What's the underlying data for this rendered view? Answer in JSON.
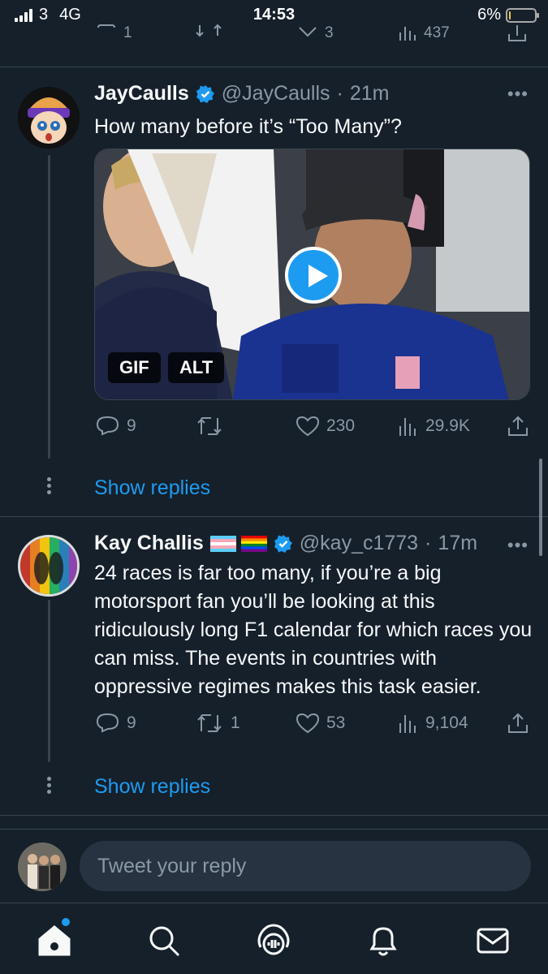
{
  "status_bar": {
    "carrier": "3",
    "network": "4G",
    "time": "14:53",
    "battery": "6%",
    "battery_level": 0.06
  },
  "top_actions": {
    "replies": "1",
    "retweets": "",
    "likes": "3",
    "views": "437"
  },
  "tweets": [
    {
      "name": "JayCaulls",
      "handle": "@JayCaulls",
      "time": "21m",
      "text": "How many before it’s “Too Many”?",
      "media_badges": [
        "GIF",
        "ALT"
      ],
      "replies": "9",
      "retweets": "",
      "likes": "230",
      "views": "29.9K",
      "show_replies": "Show replies"
    },
    {
      "name": "Kay Challis",
      "flags": "🏳️‍⚧️🏳️‍🌈",
      "handle": "@kay_c1773",
      "time": "17m",
      "text": "24 races is far too many, if you’re a big motorsport fan you’ll be looking at this ridiculously long F1 calendar for which races you can miss. The events in countries with oppressive regimes makes this task easier.",
      "replies": "9",
      "retweets": "1",
      "likes": "53",
      "views": "9,104",
      "show_replies": "Show replies"
    }
  ],
  "reply_bar": {
    "placeholder": "Tweet your reply"
  },
  "tab_bar": {
    "items": [
      "home-icon",
      "search-icon",
      "spaces-icon",
      "notifications-icon",
      "messages-icon"
    ]
  },
  "colors": {
    "background": "#15202b",
    "accent": "#1d9bf0",
    "muted": "#8b98a5"
  }
}
